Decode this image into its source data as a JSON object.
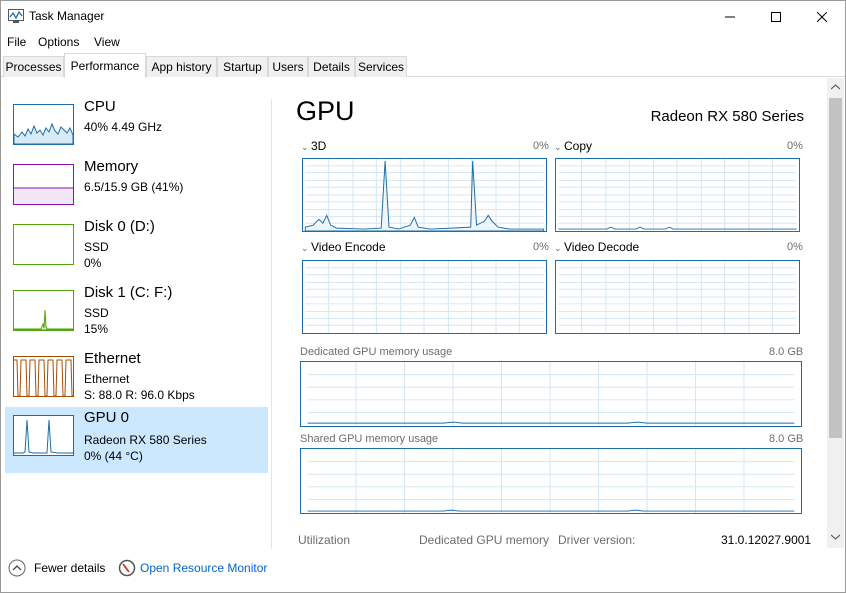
{
  "window": {
    "title": "Task Manager"
  },
  "menu": [
    "File",
    "Options",
    "View"
  ],
  "tabs": [
    "Processes",
    "Performance",
    "App history",
    "Startup",
    "Users",
    "Details",
    "Services"
  ],
  "sidebar": {
    "cpu": {
      "name": "CPU",
      "line1": "40%  4.49 GHz"
    },
    "memory": {
      "name": "Memory",
      "line1": "6.5/15.9 GB (41%)"
    },
    "disk0": {
      "name": "Disk 0 (D:)",
      "line1": "SSD",
      "line2": "0%"
    },
    "disk1": {
      "name": "Disk 1 (C: F:)",
      "line1": "SSD",
      "line2": "15%"
    },
    "ethernet": {
      "name": "Ethernet",
      "line1": "Ethernet",
      "line2": "S: 88.0  R: 96.0 Kbps"
    },
    "gpu": {
      "name": "GPU 0",
      "line1": "Radeon RX 580 Series",
      "line2": "0% (44 °C)"
    }
  },
  "main": {
    "title": "GPU",
    "model": "Radeon RX 580 Series",
    "engines": [
      {
        "label": "3D",
        "value": "0%"
      },
      {
        "label": "Copy",
        "value": "0%"
      },
      {
        "label": "Video Encode",
        "value": "0%"
      },
      {
        "label": "Video Decode",
        "value": "0%"
      }
    ],
    "dedicated_label": "Dedicated GPU memory usage",
    "dedicated_max": "8.0 GB",
    "shared_label": "Shared GPU memory usage",
    "shared_max": "8.0 GB",
    "bottom": {
      "utilization": "Utilization",
      "dedicated_memory": "Dedicated GPU memory",
      "driver_version_label": "Driver version:",
      "driver_version": "31.0.12027.9001"
    }
  },
  "footer": {
    "fewer_details": "Fewer details",
    "open_monitor": "Open Resource Monitor"
  },
  "colors": {
    "cpu": "#1b6ea8",
    "memory": "#8b12ae",
    "disk": "#4da60c",
    "ethernet": "#a74f01",
    "selected": "#cce8ff"
  }
}
